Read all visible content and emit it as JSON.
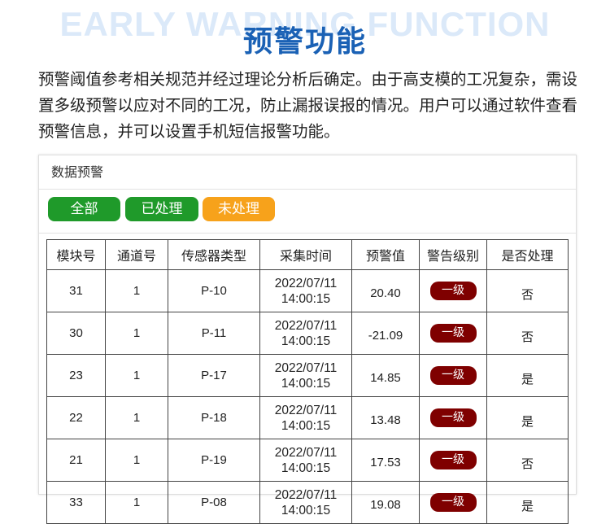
{
  "header": {
    "bg_title": "EARLY WARNING FUNCTION",
    "title": "预警功能"
  },
  "description": "预警阈值参考相关规范并经过理论分析后确定。由于高支模的工况复杂，需设置多级预警以应对不同的工况，防止漏报误报的情况。用户可以通过软件查看预警信息，并可以设置手机短信报警功能。",
  "panel": {
    "title": "数据预警",
    "filters": [
      {
        "label": "全部",
        "color": "#1f9a2a"
      },
      {
        "label": "已处理",
        "color": "#1f9a2a"
      },
      {
        "label": "未处理",
        "color": "#f7a21b"
      }
    ],
    "columns": [
      "模块号",
      "通道号",
      "传感器类型",
      "采集时间",
      "预警值",
      "警告级别",
      "是否处理"
    ],
    "rows": [
      {
        "module": "31",
        "channel": "1",
        "sensor": "P-10",
        "date": "2022/07/11",
        "time": "14:00:15",
        "value": "20.40",
        "level": "一级",
        "handled": "否"
      },
      {
        "module": "30",
        "channel": "1",
        "sensor": "P-11",
        "date": "2022/07/11",
        "time": "14:00:15",
        "value": "-21.09",
        "level": "一级",
        "handled": "否"
      },
      {
        "module": "23",
        "channel": "1",
        "sensor": "P-17",
        "date": "2022/07/11",
        "time": "14:00:15",
        "value": "14.85",
        "level": "一级",
        "handled": "是"
      },
      {
        "module": "22",
        "channel": "1",
        "sensor": "P-18",
        "date": "2022/07/11",
        "time": "14:00:15",
        "value": "13.48",
        "level": "一级",
        "handled": "是"
      },
      {
        "module": "21",
        "channel": "1",
        "sensor": "P-19",
        "date": "2022/07/11",
        "time": "14:00:15",
        "value": "17.53",
        "level": "一级",
        "handled": "否"
      },
      {
        "module": "33",
        "channel": "1",
        "sensor": "P-08",
        "date": "2022/07/11",
        "time": "14:00:15",
        "value": "19.08",
        "level": "一级",
        "handled": "是"
      }
    ],
    "level_color": "#7f0000"
  }
}
